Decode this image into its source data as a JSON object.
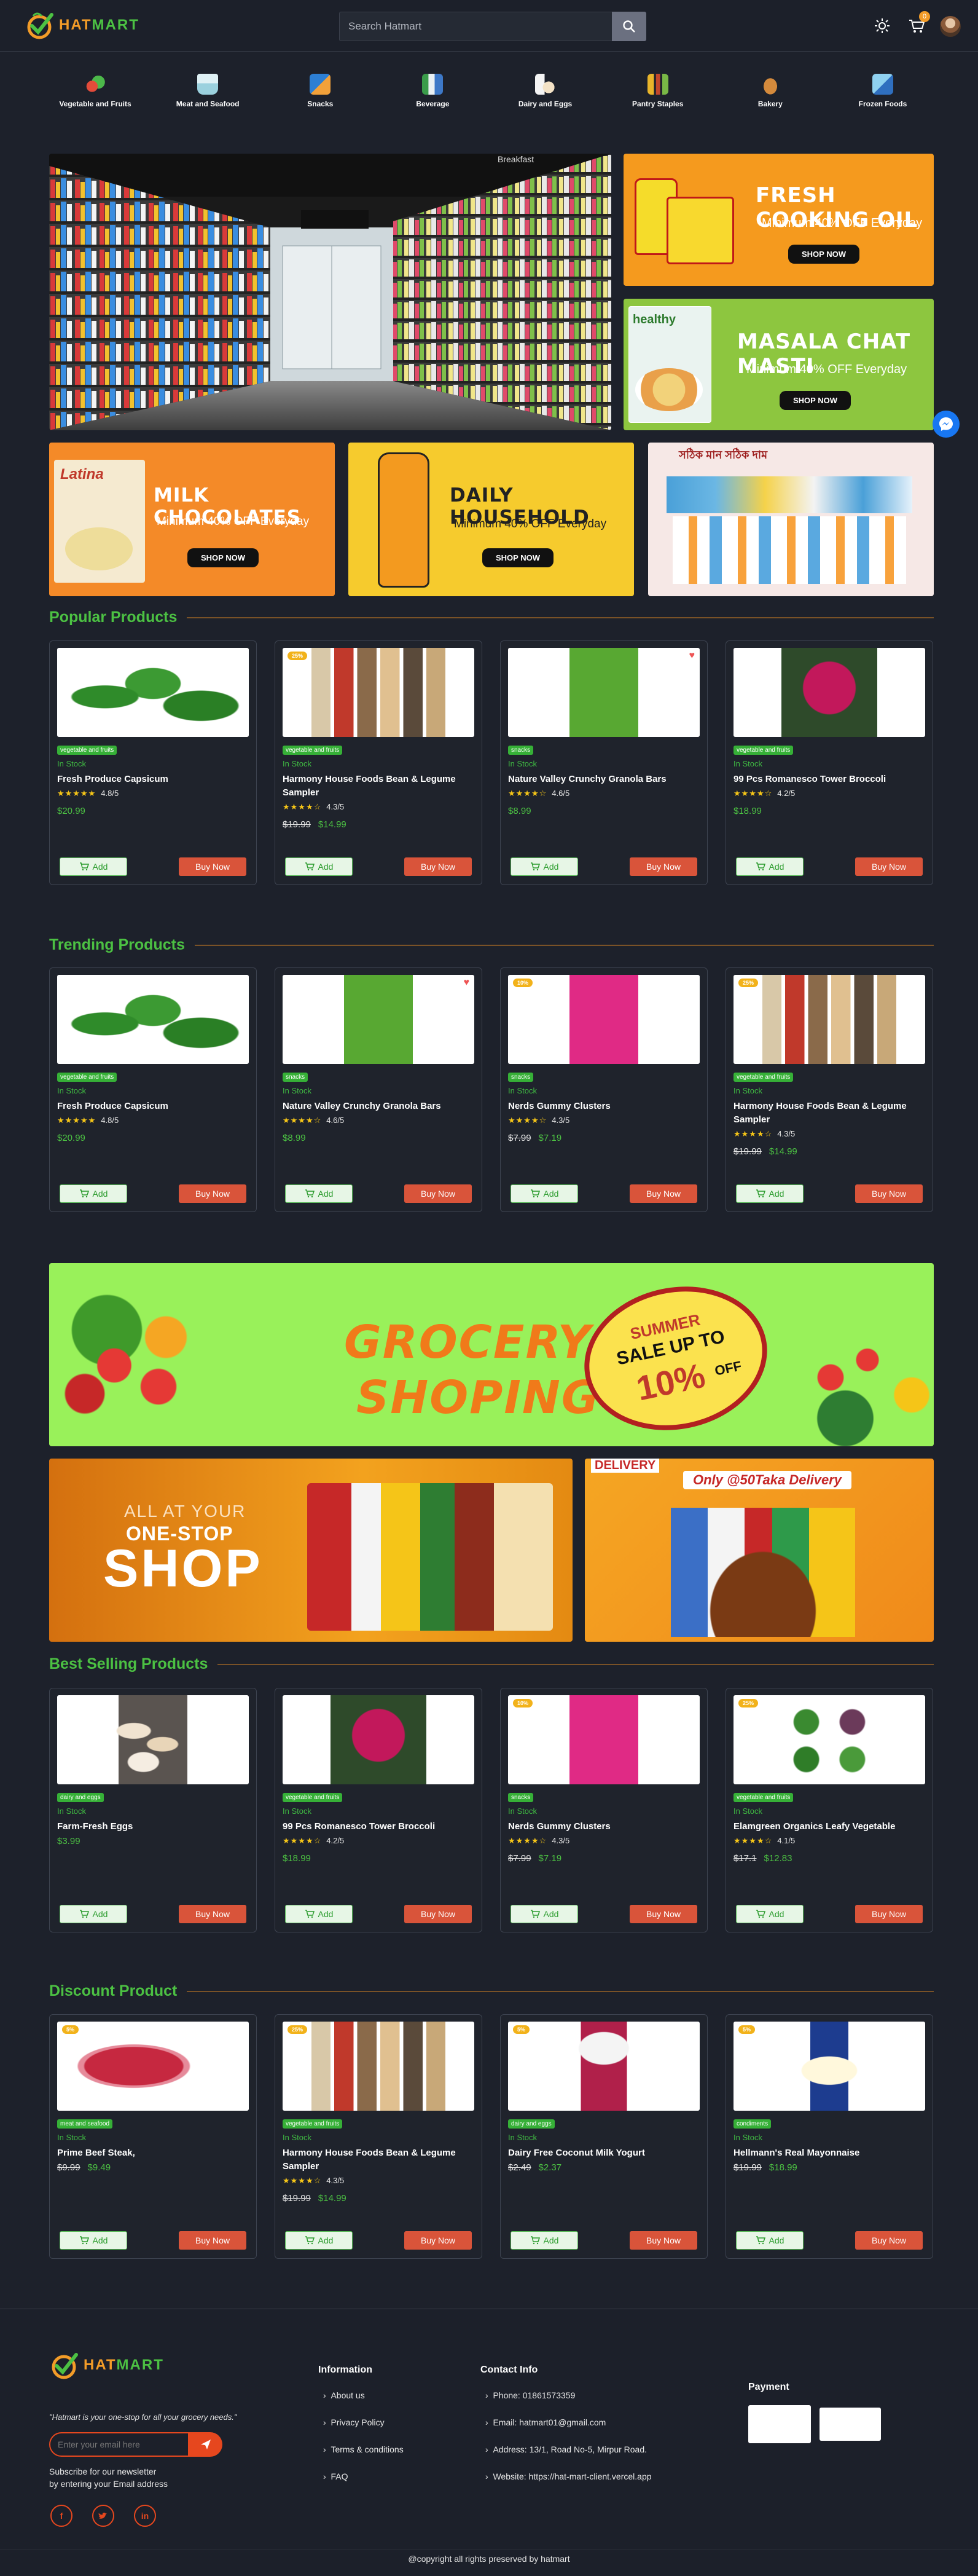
{
  "header": {
    "logo_text_a": "HAT",
    "logo_text_b": "MART",
    "search_placeholder": "Search Hatmart",
    "cart_count": "0"
  },
  "categories": [
    {
      "label": "Vegetable and Fruits",
      "icon": "vegetables-icon"
    },
    {
      "label": "Meat and Seafood",
      "icon": "meat-icon"
    },
    {
      "label": "Snacks",
      "icon": "snacks-icon"
    },
    {
      "label": "Beverage",
      "icon": "beverage-icon"
    },
    {
      "label": "Dairy and Eggs",
      "icon": "dairy-icon"
    },
    {
      "label": "Pantry Staples",
      "icon": "pantry-icon"
    },
    {
      "label": "Bakery",
      "icon": "bakery-icon"
    },
    {
      "label": "Frozen Foods",
      "icon": "frozen-icon"
    }
  ],
  "banners": {
    "store_sign": "Breakfast",
    "cooking_oil": {
      "title": "FRESH COOKING OIL",
      "sub": "Minimum 40% OFF Everyday",
      "btn": "SHOP NOW"
    },
    "masala": {
      "title": "MASALA CHAT MASTI",
      "sub": "Minimum 40% OFF Everyday",
      "btn": "SHOP NOW",
      "pack": "healthy"
    },
    "milk": {
      "title": "MILK CHOCOLATES",
      "sub": "Minimum 40% OFF Everyday",
      "btn": "SHOP NOW",
      "pack": "Latina"
    },
    "household": {
      "title": "DAILY HOUSEHOLD",
      "sub": "Minimum 40% OFF Everyday",
      "btn": "SHOP NOW"
    },
    "bengali": {
      "title": "সঠিক মান সঠিক দাম"
    },
    "grocery": {
      "title_1": "GROCERY",
      "title_2": "SHOPING",
      "badge_1": "SUMMER",
      "badge_2": "SALE UP TO",
      "badge_3": "10%",
      "badge_4": "OFF"
    },
    "shop": {
      "line1": "ALL AT YOUR",
      "line2": "ONE-STOP",
      "line3": "SHOP"
    },
    "delivery": {
      "tag": "DELIVERY",
      "text": "Only @50Taka Delivery"
    }
  },
  "sections": {
    "popular": "Popular Products",
    "trending": "Trending Products",
    "best": "Best Selling Products",
    "discount": "Discount Product"
  },
  "buttons": {
    "add": "Add",
    "buy": "Buy Now"
  },
  "popular": [
    {
      "tag": "vegetable and fruits",
      "stock": "In Stock",
      "name": "Fresh Produce Capsicum",
      "stars": "★★★★★",
      "rating": "4.8/5",
      "old": "",
      "price": "$20.99",
      "img": "capsicum"
    },
    {
      "tag": "vegetable and fruits",
      "stock": "In Stock",
      "name": "Harmony House Foods Bean & Legume Sampler",
      "stars": "★★★★☆",
      "rating": "4.3/5",
      "old": "$19.99",
      "price": "$14.99",
      "img": "sampler",
      "discount": "25%"
    },
    {
      "tag": "snacks",
      "stock": "In Stock",
      "name": "Nature Valley Crunchy Granola Bars",
      "stars": "★★★★☆",
      "rating": "4.6/5",
      "old": "",
      "price": "$8.99",
      "img": "granola",
      "fav": true
    },
    {
      "tag": "vegetable and fruits",
      "stock": "In Stock",
      "name": "99 Pcs Romanesco Tower Broccoli",
      "stars": "★★★★☆",
      "rating": "4.2/5",
      "old": "",
      "price": "$18.99",
      "img": "broccoli"
    }
  ],
  "trending": [
    {
      "tag": "vegetable and fruits",
      "stock": "In Stock",
      "name": "Fresh Produce Capsicum",
      "stars": "★★★★★",
      "rating": "4.8/5",
      "old": "",
      "price": "$20.99",
      "img": "capsicum"
    },
    {
      "tag": "snacks",
      "stock": "In Stock",
      "name": "Nature Valley Crunchy Granola Bars",
      "stars": "★★★★☆",
      "rating": "4.6/5",
      "old": "",
      "price": "$8.99",
      "img": "granola",
      "fav": true
    },
    {
      "tag": "snacks",
      "stock": "In Stock",
      "name": "Nerds Gummy Clusters",
      "stars": "★★★★☆",
      "rating": "4.3/5",
      "old": "$7.99",
      "price": "$7.19",
      "img": "nerds",
      "discount": "10%"
    },
    {
      "tag": "vegetable and fruits",
      "stock": "In Stock",
      "name": "Harmony House Foods Bean & Legume Sampler",
      "stars": "★★★★☆",
      "rating": "4.3/5",
      "old": "$19.99",
      "price": "$14.99",
      "img": "sampler",
      "discount": "25%"
    }
  ],
  "best": [
    {
      "tag": "dairy and eggs",
      "stock": "In Stock",
      "name": "Farm-Fresh Eggs",
      "stars": "",
      "rating": "",
      "old": "",
      "price": "$3.99",
      "img": "eggs"
    },
    {
      "tag": "vegetable and fruits",
      "stock": "In Stock",
      "name": "99 Pcs Romanesco Tower Broccoli",
      "stars": "★★★★☆",
      "rating": "4.2/5",
      "old": "",
      "price": "$18.99",
      "img": "broccoli"
    },
    {
      "tag": "snacks",
      "stock": "In Stock",
      "name": "Nerds Gummy Clusters",
      "stars": "★★★★☆",
      "rating": "4.3/5",
      "old": "$7.99",
      "price": "$7.19",
      "img": "nerds",
      "discount": "10%"
    },
    {
      "tag": "vegetable and fruits",
      "stock": "In Stock",
      "name": "Elamgreen Organics Leafy Vegetable",
      "stars": "★★★★☆",
      "rating": "4.1/5",
      "old": "$17.1",
      "price": "$12.83",
      "img": "leafy",
      "discount": "25%"
    }
  ],
  "discount": [
    {
      "tag": "meat and seafood",
      "stock": "In Stock",
      "name": "Prime Beef Steak,",
      "stars": "",
      "rating": "",
      "old": "$9.99",
      "price": "$9.49",
      "img": "beef",
      "discount": "5%"
    },
    {
      "tag": "vegetable and fruits",
      "stock": "In Stock",
      "name": "Harmony House Foods Bean & Legume Sampler",
      "stars": "★★★★☆",
      "rating": "4.3/5",
      "old": "$19.99",
      "price": "$14.99",
      "img": "sampler",
      "discount": "25%"
    },
    {
      "tag": "dairy and eggs",
      "stock": "In Stock",
      "name": "Dairy Free Coconut Milk Yogurt",
      "stars": "",
      "rating": "",
      "old": "$2.49",
      "price": "$2.37",
      "img": "yogurt",
      "discount": "5%"
    },
    {
      "tag": "condiments",
      "stock": "In Stock",
      "name": "Hellmann's Real Mayonnaise",
      "stars": "",
      "rating": "",
      "old": "$19.99",
      "price": "$18.99",
      "img": "mayo",
      "discount": "5%"
    }
  ],
  "footer": {
    "tagline": "\"Hatmart is your one-stop for all your grocery needs.\"",
    "email_placeholder": "Enter your email here",
    "newsletter_1": "Subscribe for our newsletter",
    "newsletter_2": "by entering your Email address",
    "info_head": "Information",
    "info_links": [
      "About us",
      "Privacy Policy",
      "Terms & conditions",
      "FAQ"
    ],
    "contact_head": "Contact Info",
    "contact": [
      "Phone: 01861573359",
      "Email: hatmart01@gmail.com",
      "Address: 13/1, Road No-5, Mirpur Road.",
      "Website: https://hat-mart-client.vercel.app"
    ],
    "payment_head": "Payment",
    "copyright": "@copyright all rights preserved by hatmart"
  },
  "colors": {
    "brand_orange": "#f39c28",
    "brand_green": "#4cc143",
    "buy_red": "#d9543a",
    "background": "#1d212b"
  }
}
